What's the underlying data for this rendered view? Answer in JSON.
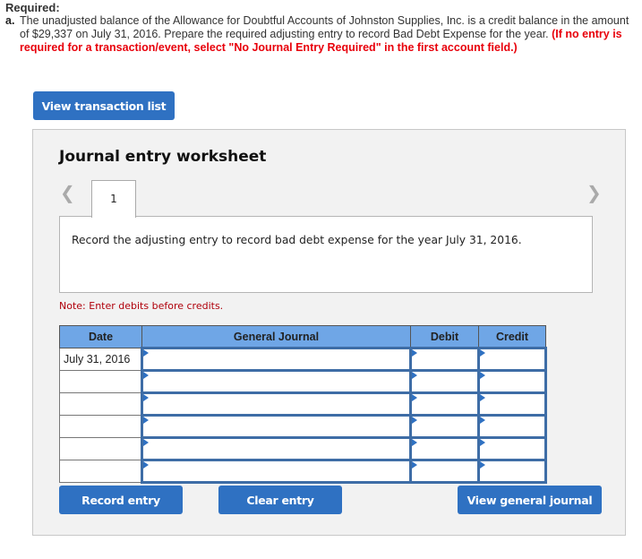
{
  "required": {
    "title": "Required:",
    "item_label": "a.",
    "text": "The unadjusted balance of the Allowance for Doubtful Accounts of Johnston Supplies, Inc. is a credit balance in the amount of $29,337 on July 31, 2016. Prepare the required adjusting entry to record Bad Debt Expense for the year.",
    "instruction": "(If no entry is required for a transaction/event, select \"No Journal Entry Required\" in the first account field.)"
  },
  "buttons": {
    "view_transaction_list": "View transaction list",
    "record_entry": "Record entry",
    "clear_entry": "Clear entry",
    "view_general_journal": "View general journal"
  },
  "worksheet": {
    "title": "Journal entry worksheet",
    "prev_icon": "chevron-left-icon",
    "next_icon": "chevron-right-icon",
    "tab_label": "1",
    "description": "Record the adjusting entry to record bad debt expense for the year July 31, 2016.",
    "note": "Note: Enter debits before credits."
  },
  "table": {
    "headers": [
      "Date",
      "General Journal",
      "Debit",
      "Credit"
    ],
    "rows": [
      {
        "date": "July 31, 2016",
        "account": "",
        "debit": "",
        "credit": ""
      },
      {
        "date": "",
        "account": "",
        "debit": "",
        "credit": ""
      },
      {
        "date": "",
        "account": "",
        "debit": "",
        "credit": ""
      },
      {
        "date": "",
        "account": "",
        "debit": "",
        "credit": ""
      },
      {
        "date": "",
        "account": "",
        "debit": "",
        "credit": ""
      },
      {
        "date": "",
        "account": "",
        "debit": "",
        "credit": ""
      }
    ]
  },
  "colors": {
    "button_blue": "#2f71c2",
    "header_blue": "#6fa6e6",
    "instruction_red": "#e8000b",
    "note_red": "#b0000b",
    "panel_bg": "#f2f2f2"
  }
}
